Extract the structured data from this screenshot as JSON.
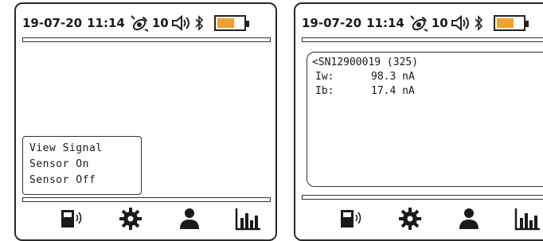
{
  "left_screen": {
    "status": {
      "date": "19-07-20",
      "time": "11:14",
      "signal_count": "10"
    },
    "battery_level": 0.65,
    "menu": {
      "items": [
        "View Signal",
        "Sensor On",
        "Sensor Off"
      ]
    },
    "nav_icons": [
      "sensor-icon",
      "gear-icon",
      "person-icon",
      "bar-chart-icon"
    ]
  },
  "right_screen": {
    "status": {
      "date": "19-07-20",
      "time": "11:14",
      "signal_count": "10"
    },
    "battery_level": 0.65,
    "detail": {
      "title": "<SN12900019 (325)",
      "readings": [
        {
          "label": "Iw:",
          "value": "98.3 nA"
        },
        {
          "label": "Ib:",
          "value": "17.4 nA"
        }
      ]
    },
    "nav_icons": [
      "sensor-icon",
      "gear-icon",
      "person-icon",
      "bar-chart-icon"
    ]
  },
  "colors": {
    "battery_fill": "#f0a12b",
    "frame": "#2a2a2a"
  }
}
